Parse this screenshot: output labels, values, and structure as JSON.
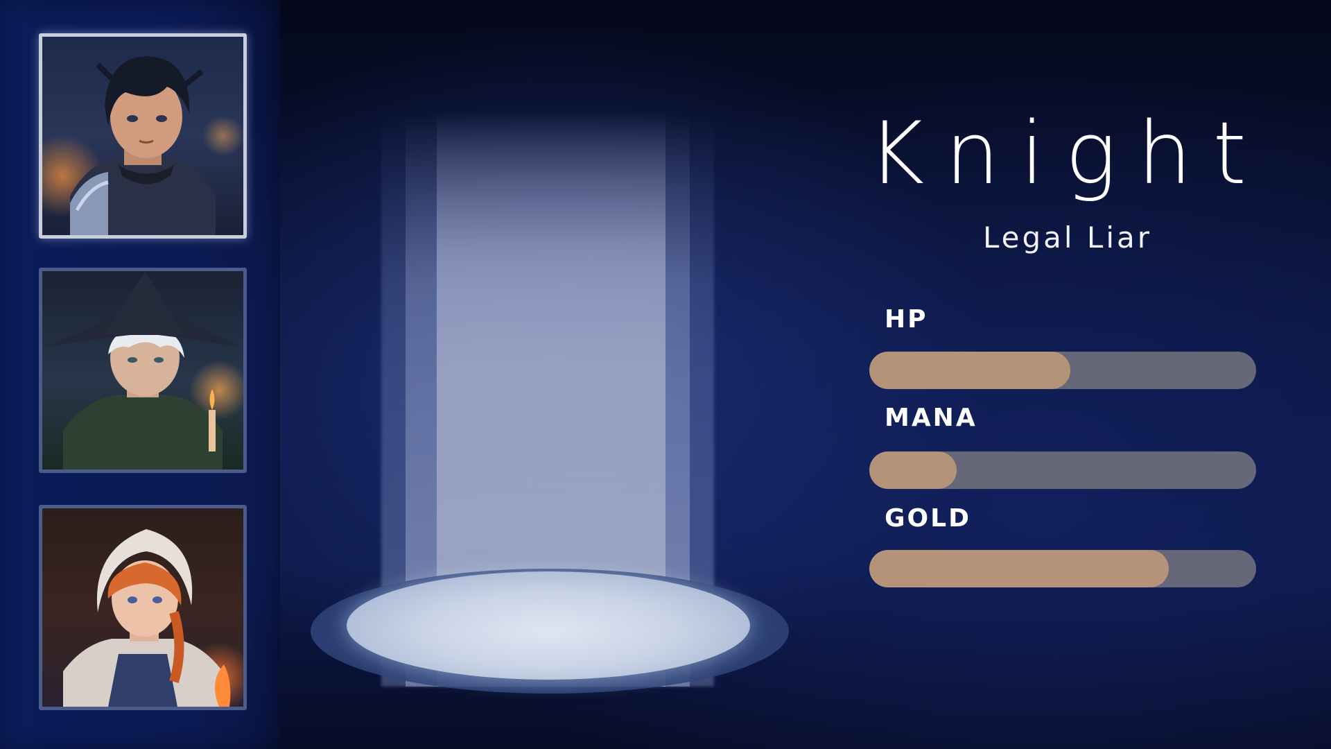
{
  "character": {
    "name": "Knight",
    "title": "Legal Liar"
  },
  "portraits": [
    {
      "id": "knight",
      "selected": true
    },
    {
      "id": "mage",
      "selected": false
    },
    {
      "id": "villager-girl",
      "selected": false
    }
  ],
  "stats": [
    {
      "label": "HP",
      "fill": 0.52
    },
    {
      "label": "MANA",
      "fill": 0.225
    },
    {
      "label": "GOLD",
      "fill": 0.775
    }
  ],
  "colors": {
    "bar_fill": "#b59379",
    "bar_track": "#67677a",
    "selected_border": "#c9cedc",
    "unselected_border": "#4a5c8a"
  }
}
